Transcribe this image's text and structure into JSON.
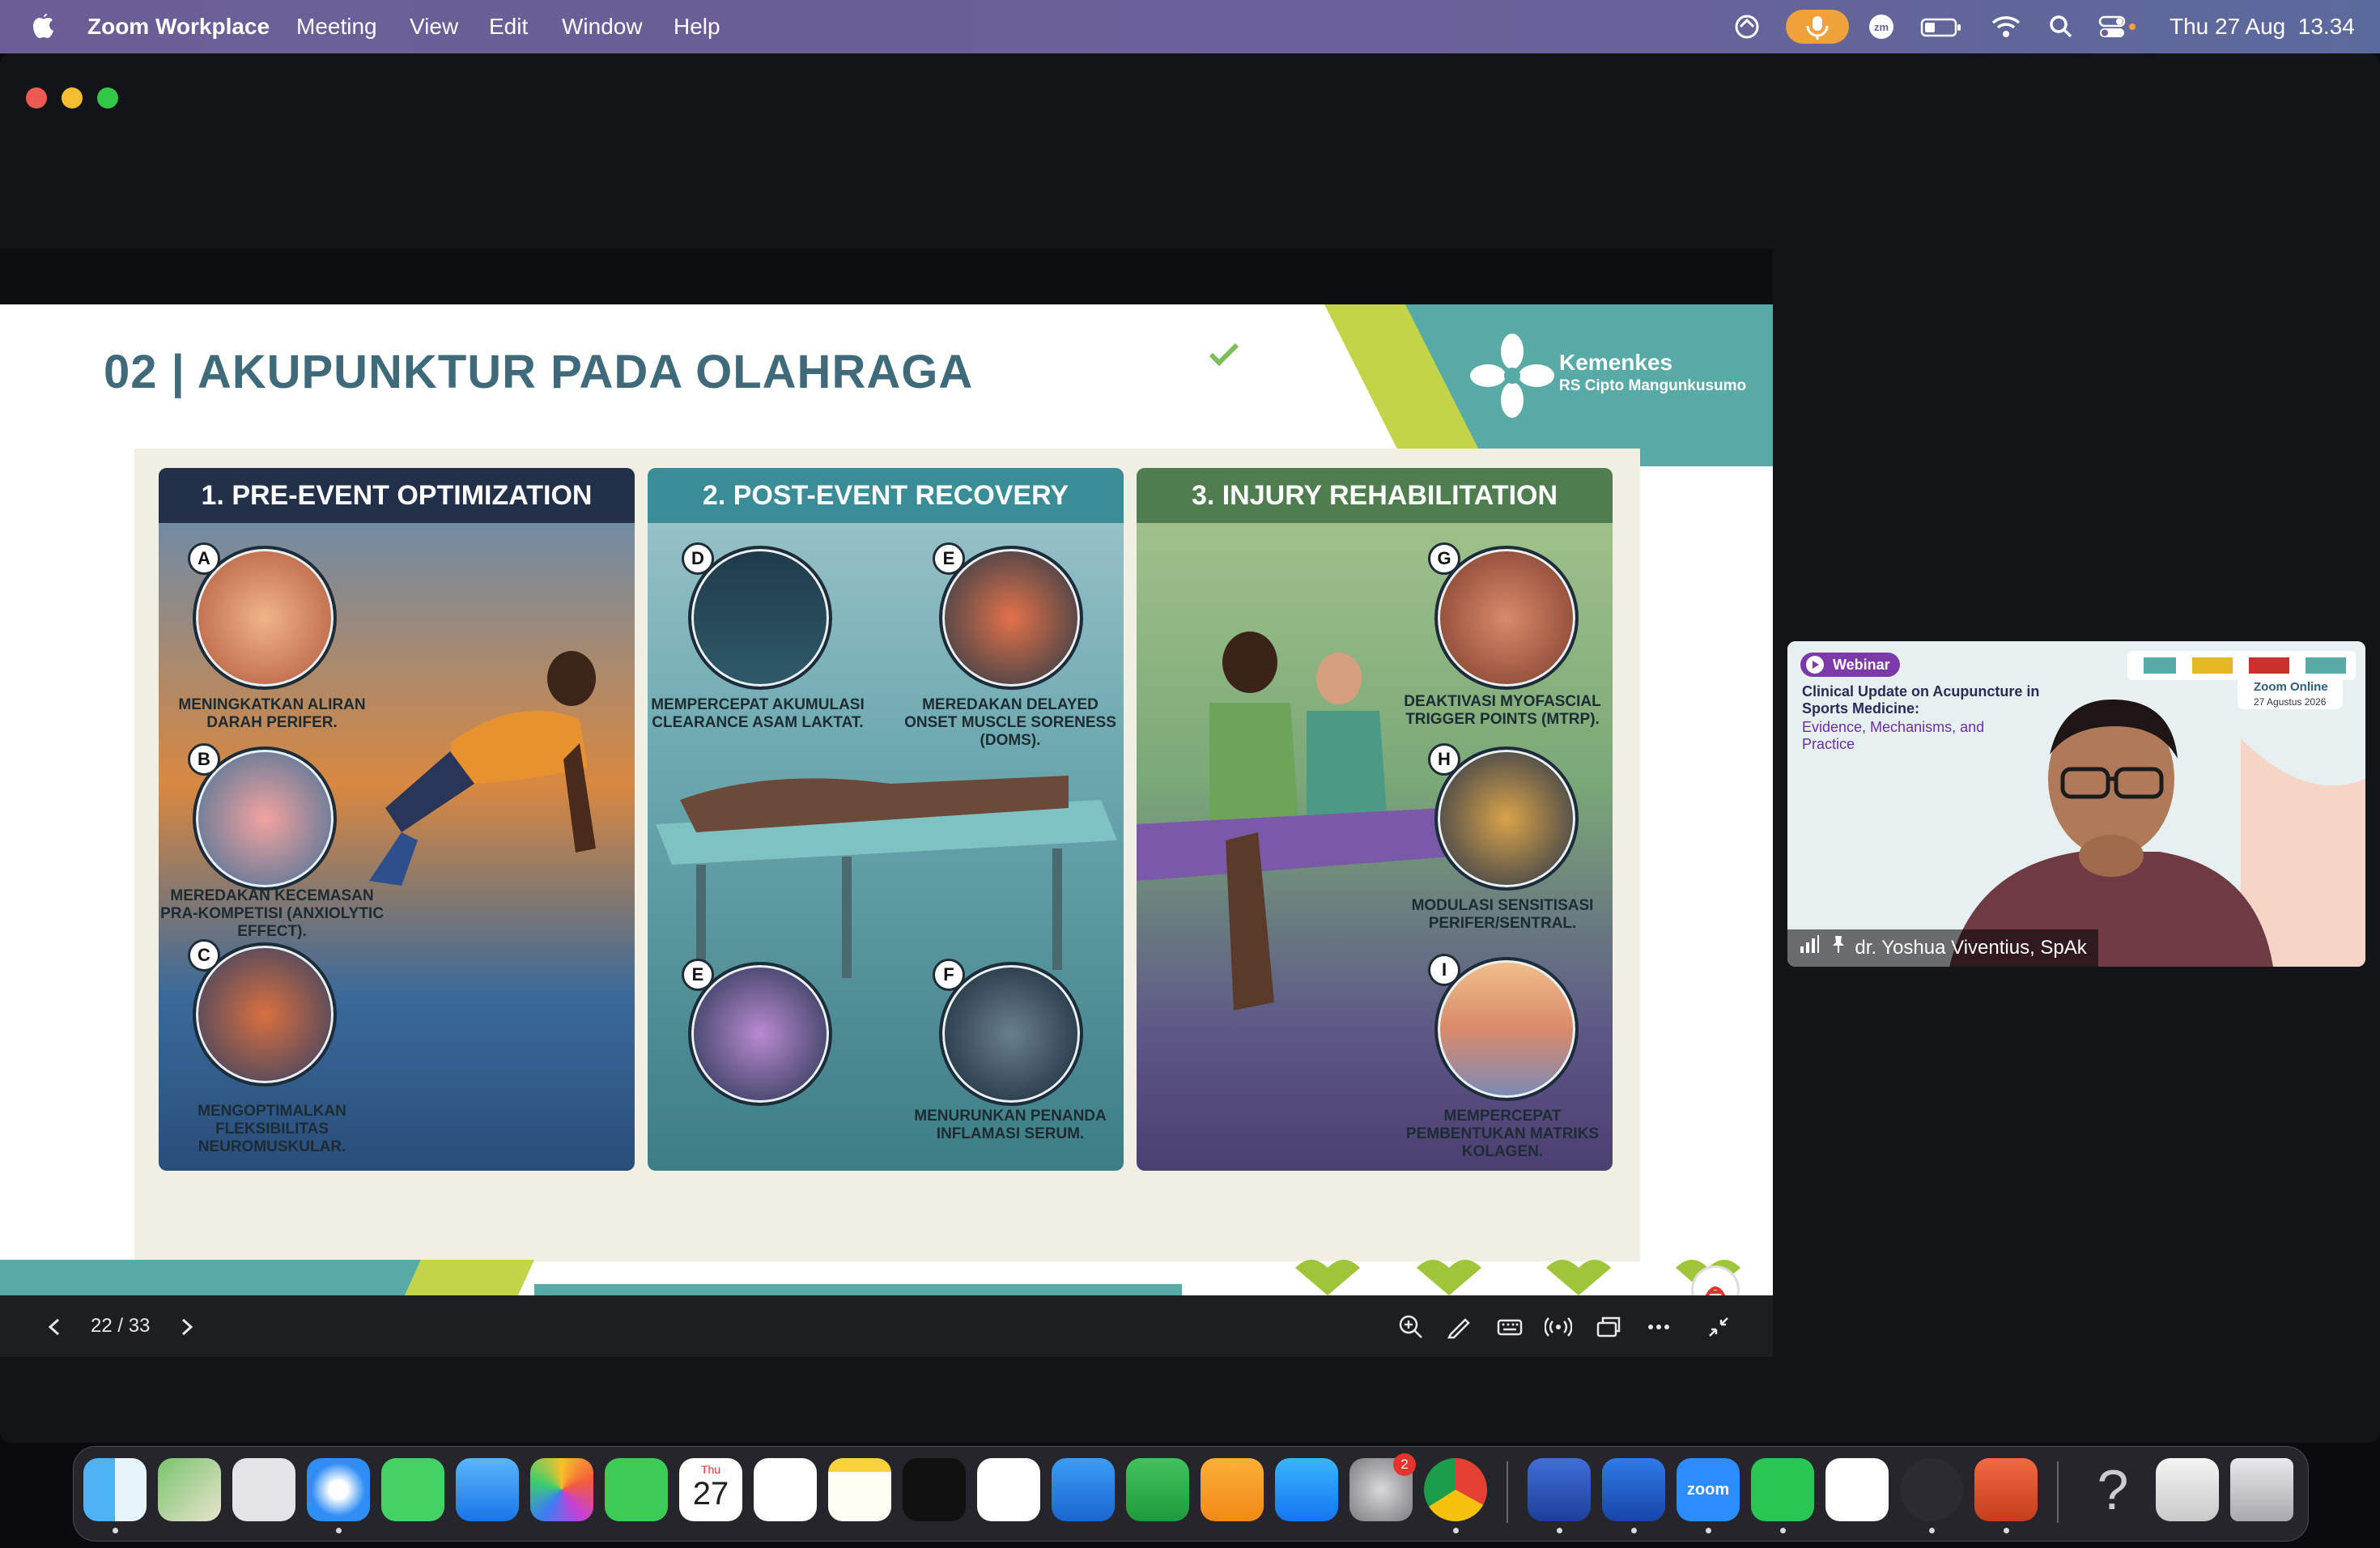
{
  "menubar": {
    "app_name": "Zoom Workplace",
    "menus": [
      "Meeting",
      "View",
      "Edit",
      "Window",
      "Help"
    ],
    "datetime": "Thu 27 Aug  13.34"
  },
  "slide": {
    "title": "02 | AKUPUNKTUR PADA OLAHRAGA",
    "logo_name": "Kemenkes",
    "logo_sub": "RS Cipto Mangunkusumo",
    "panels": [
      {
        "heading": "1. PRE-EVENT OPTIMIZATION",
        "items": [
          {
            "badge": "A",
            "caption": "MENINGKATKAN ALIRAN DARAH PERIFER."
          },
          {
            "badge": "B",
            "caption": "MEREDAKAN KECEMASAN PRA-KOMPETISI (ANXIOLYTIC EFFECT)."
          },
          {
            "badge": "C",
            "caption": "MENGOPTIMALKAN FLEKSIBILITAS NEUROMUSKULAR."
          }
        ]
      },
      {
        "heading": "2. POST-EVENT RECOVERY",
        "items": [
          {
            "badge": "D",
            "caption": "MEMPERCEPAT AKUMULASI CLEARANCE ASAM LAKTAT."
          },
          {
            "badge": "E",
            "caption": "MEREDAKAN DELAYED ONSET MUSCLE SORENESS (DOMS)."
          },
          {
            "badge": "E",
            "caption": ""
          },
          {
            "badge": "F",
            "caption": "MENURUNKAN PENANDA INFLAMASI SERUM."
          }
        ]
      },
      {
        "heading": "3. INJURY REHABILITATION",
        "items": [
          {
            "badge": "G",
            "caption": "DEAKTIVASI MYOFASCIAL TRIGGER POINTS (MTRP)."
          },
          {
            "badge": "H",
            "caption": "MODULASI SENSITISASI PERIFER/SENTRAL."
          },
          {
            "badge": "I",
            "caption": "MEMPERCEPAT PEMBENTUKAN MATRIKS KOLAGEN."
          }
        ]
      }
    ]
  },
  "controls": {
    "page_indicator": "22 / 33"
  },
  "video": {
    "participant_name": "dr. Yoshua Viventius, SpAk",
    "webinar_tag": "Webinar",
    "webinar_title": "Clinical Update on Acupuncture in Sports Medicine:",
    "webinar_subtitle": "Evidence, Mechanisms, and Practice",
    "zoom_online": "Zoom Online",
    "date_small": "27 Agustus 2026"
  },
  "dock": {
    "calendar_month": "Thu",
    "calendar_day": "27",
    "settings_badge": "2",
    "zoom_label": "zoom"
  },
  "colors": {
    "menubar": "#6c5e95",
    "slide_title": "#3f6a7a",
    "panel1": "#2c3f66",
    "panel2": "#3f8c93",
    "panel3": "#4d7b4c",
    "mic": "#f0a23a"
  }
}
